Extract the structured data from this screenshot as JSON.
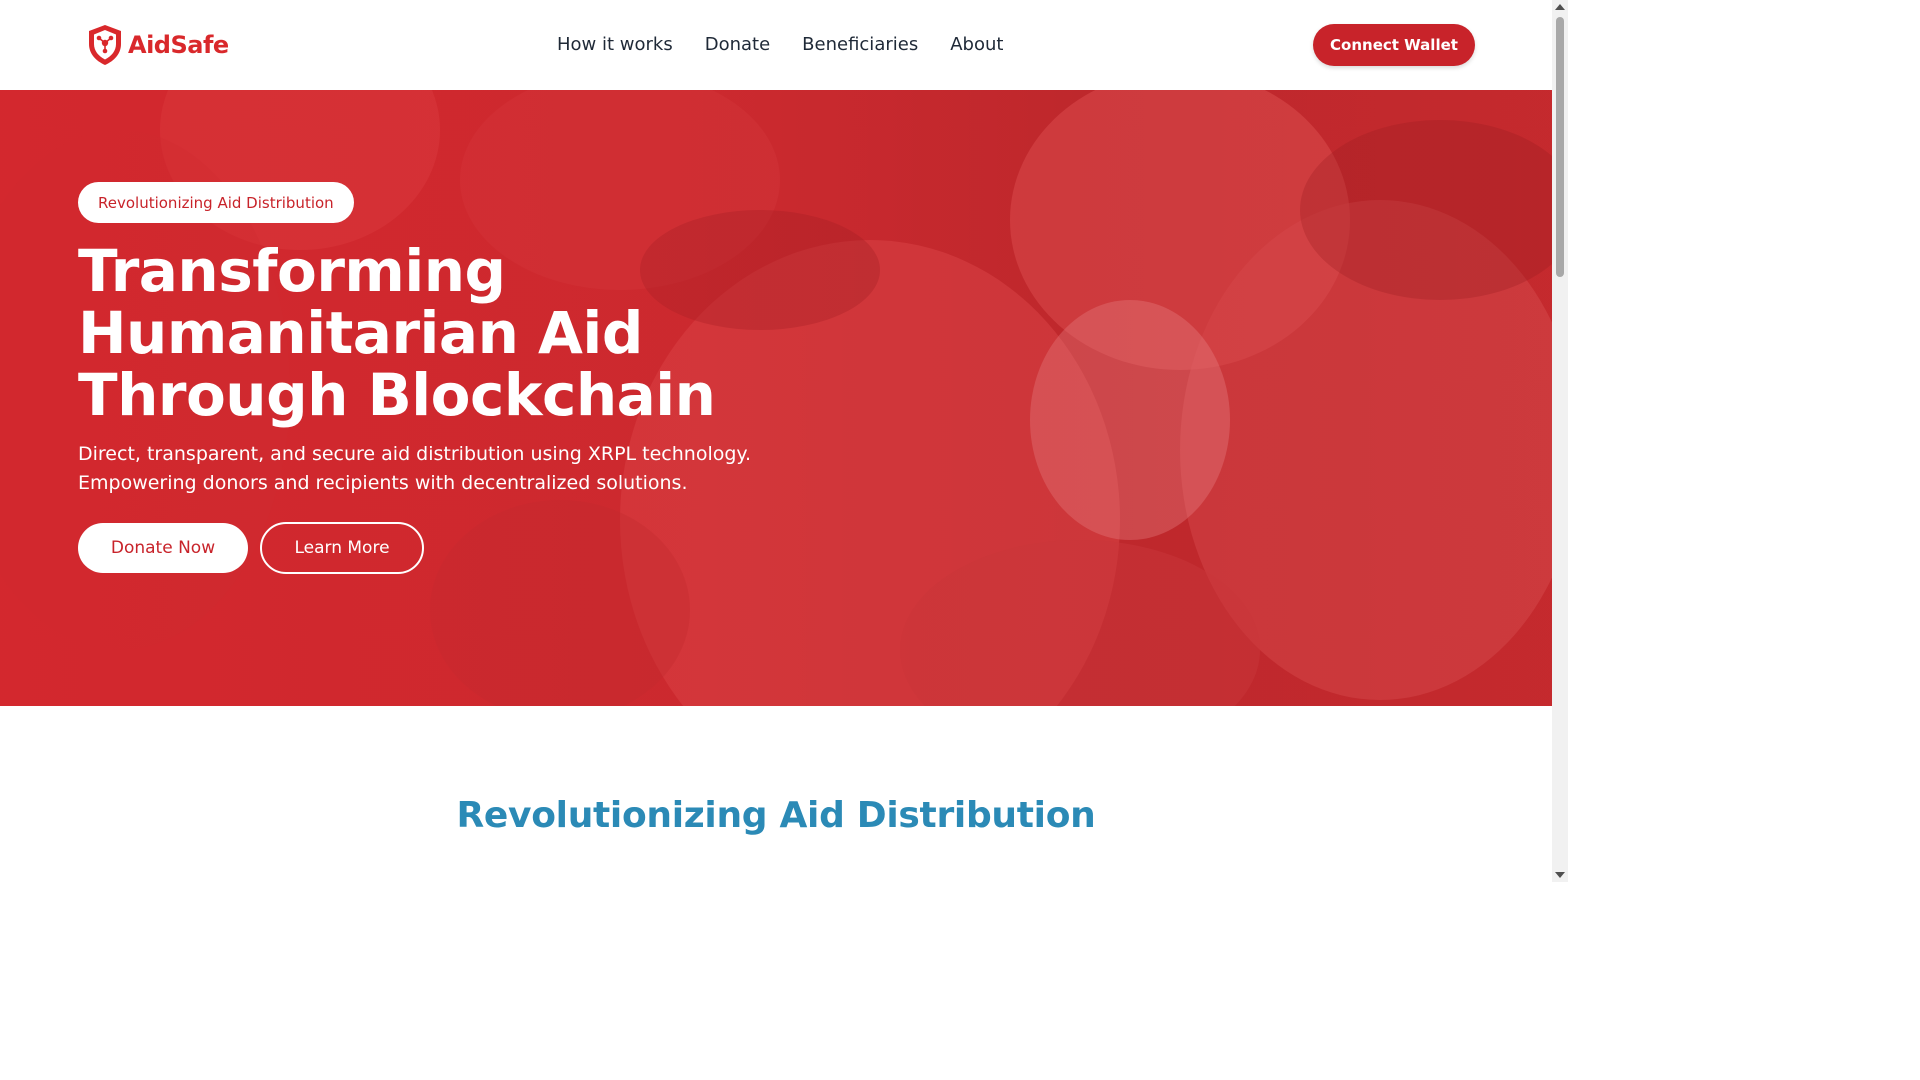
{
  "header": {
    "brand_name": "AidSafe",
    "brand_icon": "shield-network-icon",
    "nav": [
      {
        "label": "How it works"
      },
      {
        "label": "Donate"
      },
      {
        "label": "Beneficiaries"
      },
      {
        "label": "About"
      }
    ],
    "connect_label": "Connect Wallet"
  },
  "hero": {
    "badge": "Revolutionizing Aid Distribution",
    "title_lines": [
      "Transforming",
      "Humanitarian Aid",
      "Through Blockchain"
    ],
    "subtitle_lines": [
      "Direct, transparent, and secure aid distribution using XRPL technology.",
      "Empowering donors and recipients with decentralized solutions."
    ],
    "donate_label": "Donate Now",
    "learn_label": "Learn More"
  },
  "section": {
    "title": "Revolutionizing Aid Distribution"
  },
  "colors": {
    "brand_red": "#d9282b",
    "button_red": "#c8232a",
    "section_title_blue": "#2b8ab6"
  }
}
